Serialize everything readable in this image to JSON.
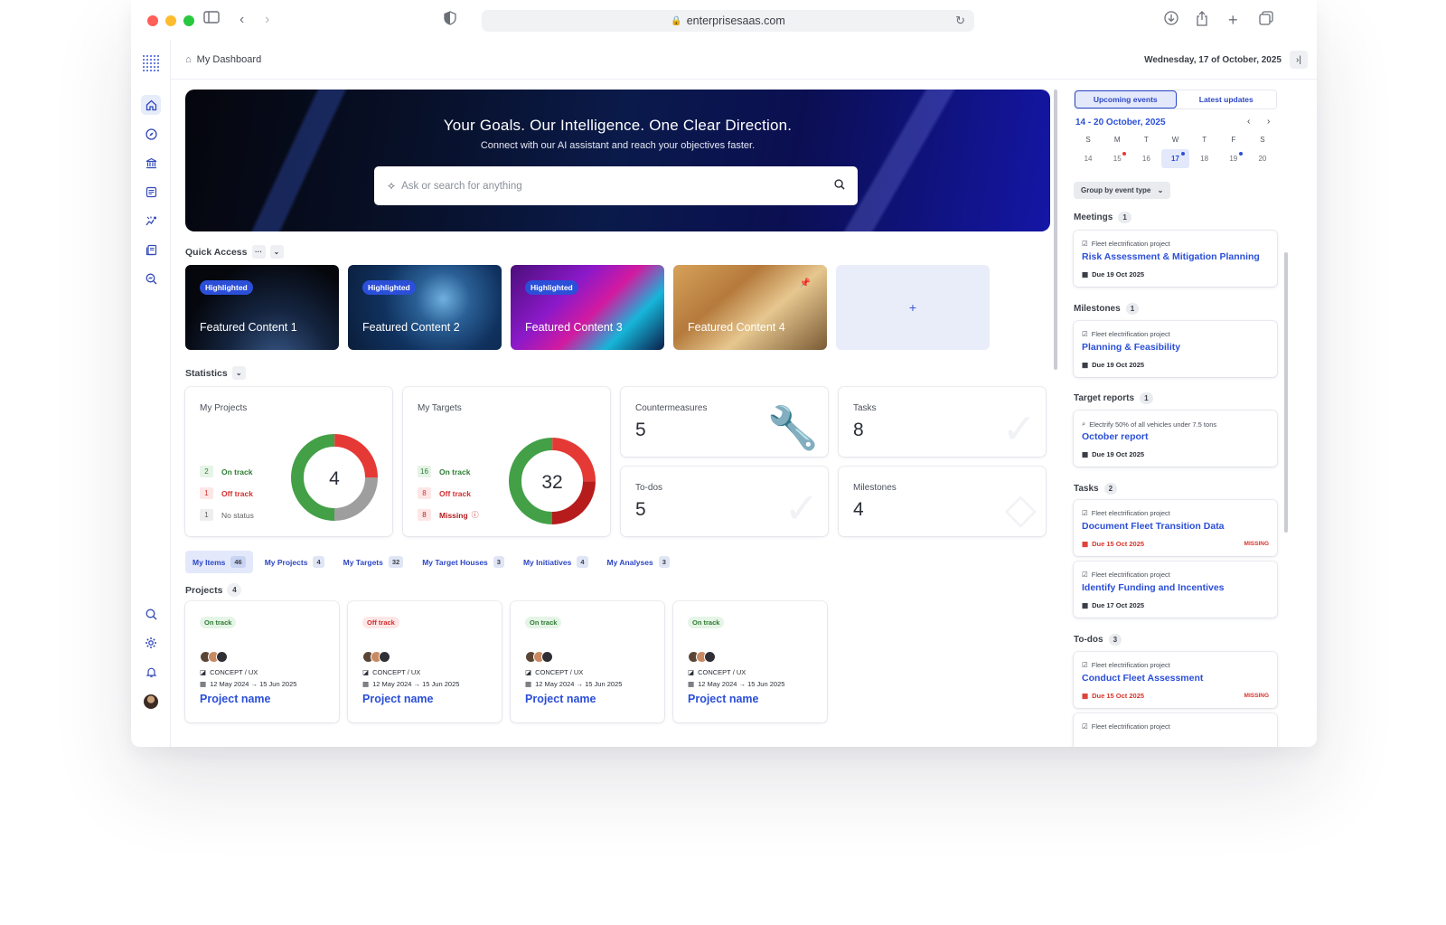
{
  "browser": {
    "url": "enterprisesaas.com",
    "traffic_colors": [
      "#ff5f57",
      "#febc2e",
      "#28c840"
    ]
  },
  "topbar": {
    "breadcrumb": "My Dashboard",
    "date": "Wednesday, 17 of October, 2025"
  },
  "hero": {
    "title": "Your Goals. Our Intelligence. One Clear Direction.",
    "subtitle": "Connect with our AI assistant and reach your objectives faster.",
    "search_placeholder": "Ask or search for anything"
  },
  "quick_access": {
    "label": "Quick Access",
    "more": "···",
    "add": "+",
    "cards": [
      {
        "title": "Featured Content 1",
        "badge": "Highlighted"
      },
      {
        "title": "Featured Content 2",
        "badge": "Highlighted"
      },
      {
        "title": "Featured Content 3",
        "badge": "Highlighted"
      },
      {
        "title": "Featured Content 4",
        "badge": ""
      }
    ]
  },
  "statistics": {
    "label": "Statistics",
    "my_projects": {
      "title": "My Projects",
      "total": "4",
      "legend": [
        {
          "count": "2",
          "label": "On track"
        },
        {
          "count": "1",
          "label": "Off track"
        },
        {
          "count": "1",
          "label": "No status"
        }
      ],
      "segments": [
        2,
        1,
        1
      ]
    },
    "my_targets": {
      "title": "My Targets",
      "total": "32",
      "legend": [
        {
          "count": "16",
          "label": "On track"
        },
        {
          "count": "8",
          "label": "Off track"
        },
        {
          "count": "8",
          "label": "Missing"
        }
      ],
      "segments": [
        16,
        8,
        8
      ]
    },
    "tiles": [
      {
        "title": "Countermeasures",
        "value": "5"
      },
      {
        "title": "Tasks",
        "value": "8"
      },
      {
        "title": "To-dos",
        "value": "5"
      },
      {
        "title": "Milestones",
        "value": "4"
      }
    ]
  },
  "colors": {
    "on_track": "#43a047",
    "off_track": "#e53935",
    "no_status": "#9e9e9e",
    "missing": "#b71c1c",
    "accent": "#2b4fd8"
  },
  "item_tabs": [
    {
      "label": "My Items",
      "count": "46"
    },
    {
      "label": "My Projects",
      "count": "4"
    },
    {
      "label": "My Targets",
      "count": "32"
    },
    {
      "label": "My Target Houses",
      "count": "3"
    },
    {
      "label": "My Initiatives",
      "count": "4"
    },
    {
      "label": "My Analyses",
      "count": "3"
    }
  ],
  "projects": {
    "label": "Projects",
    "count": "4",
    "cards": [
      {
        "status": "On track",
        "category": "CONCEPT / UX",
        "dates": "12 May 2024 → 15 Jun 2025",
        "name": "Project name"
      },
      {
        "status": "Off track",
        "category": "CONCEPT / UX",
        "dates": "12 May 2024 → 15 Jun 2025",
        "name": "Project name"
      },
      {
        "status": "On track",
        "category": "CONCEPT / UX",
        "dates": "12 May 2024 → 15 Jun 2025",
        "name": "Project name"
      },
      {
        "status": "On track",
        "category": "CONCEPT / UX",
        "dates": "12 May 2024 → 15 Jun 2025",
        "name": "Project name"
      }
    ]
  },
  "side_panel": {
    "tabs": [
      "Upcoming events",
      "Latest updates"
    ],
    "week": "14 - 20 October, 2025",
    "day_names": [
      "S",
      "M",
      "T",
      "W",
      "T",
      "F",
      "S"
    ],
    "days": [
      "14",
      "15",
      "16",
      "17",
      "18",
      "19",
      "20"
    ],
    "group_by": "Group by event type",
    "sections": [
      {
        "title": "Meetings",
        "count": "1"
      },
      {
        "title": "Milestones",
        "count": "1"
      },
      {
        "title": "Target reports",
        "count": "1"
      },
      {
        "title": "Tasks",
        "count": "2"
      },
      {
        "title": "To-dos",
        "count": "3"
      }
    ],
    "events": [
      {
        "project": "Fleet electrification project",
        "title": "Risk Assessment & Mitigation Planning",
        "due": "Due 19 Oct 2025",
        "missing": ""
      },
      {
        "project": "Fleet electrification project",
        "title": "Planning & Feasibility",
        "due": "Due 19 Oct 2025",
        "missing": ""
      },
      {
        "project": "Electrify 50% of all vehicles under 7.5 tons",
        "title": "October report",
        "due": "Due 19 Oct 2025",
        "missing": ""
      },
      {
        "project": "Fleet electrification project",
        "title": "Document Fleet Transition Data",
        "due": "Due 15 Oct 2025",
        "missing": "MISSING"
      },
      {
        "project": "Fleet electrification project",
        "title": "Identify Funding and Incentives",
        "due": "Due 17 Oct 2025",
        "missing": ""
      },
      {
        "project": "Fleet electrification project",
        "title": "Conduct Fleet Assessment",
        "due": "Due 15 Oct 2025",
        "missing": "MISSING"
      },
      {
        "project": "Fleet electrification project",
        "title": "",
        "due": "",
        "missing": ""
      }
    ]
  }
}
